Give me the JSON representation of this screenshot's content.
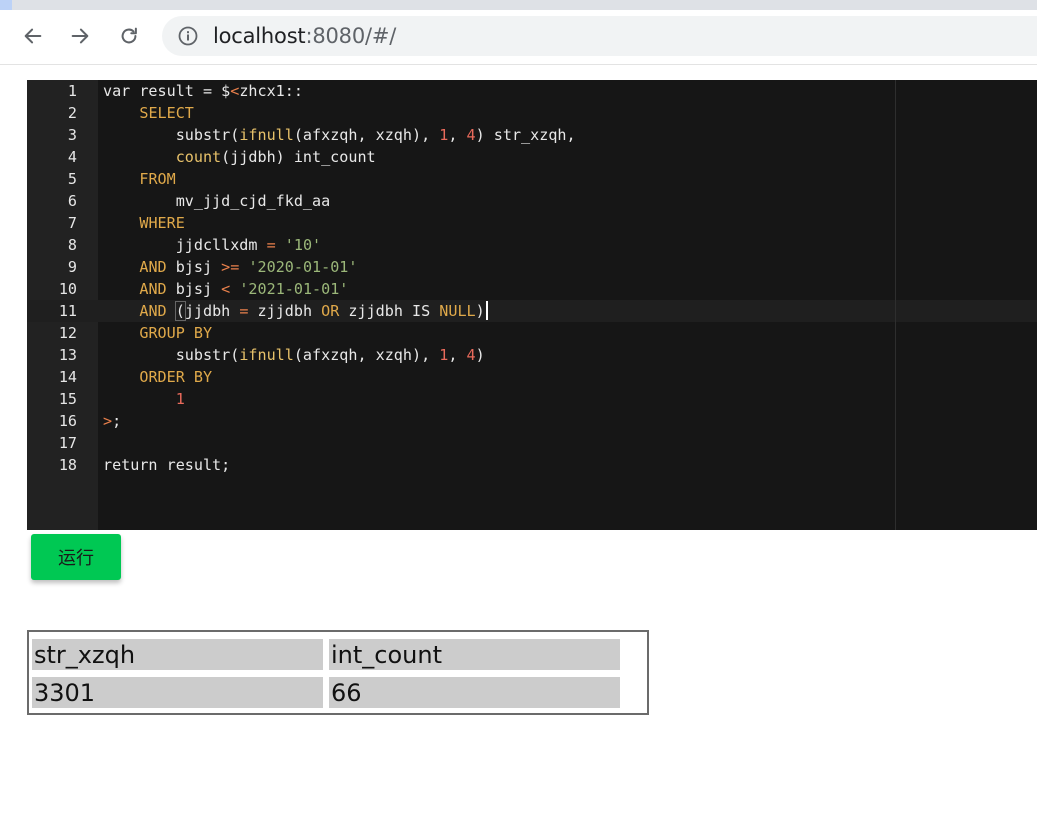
{
  "browser": {
    "url_host": "localhost",
    "url_rest": ":8080/#/"
  },
  "editor": {
    "active_line": 11,
    "lines": [
      {
        "n": "1",
        "tokens": [
          [
            "",
            "var result = $"
          ],
          [
            "op",
            "<"
          ],
          [
            "",
            "zhcx1::"
          ]
        ]
      },
      {
        "n": "2",
        "tokens": [
          [
            "",
            "    "
          ],
          [
            "kw",
            "SELECT"
          ]
        ]
      },
      {
        "n": "3",
        "tokens": [
          [
            "",
            "        substr("
          ],
          [
            "fn",
            "ifnull"
          ],
          [
            "",
            "(afxzqh, xzqh), "
          ],
          [
            "num",
            "1"
          ],
          [
            "",
            ", "
          ],
          [
            "num",
            "4"
          ],
          [
            "",
            ") str_xzqh,"
          ]
        ]
      },
      {
        "n": "4",
        "tokens": [
          [
            "",
            "        "
          ],
          [
            "fn",
            "count"
          ],
          [
            "",
            "(jjdbh) int_count"
          ]
        ]
      },
      {
        "n": "5",
        "tokens": [
          [
            "",
            "    "
          ],
          [
            "kw",
            "FROM"
          ]
        ]
      },
      {
        "n": "6",
        "tokens": [
          [
            "",
            "        mv_jjd_cjd_fkd_aa"
          ]
        ]
      },
      {
        "n": "7",
        "tokens": [
          [
            "",
            "    "
          ],
          [
            "kw",
            "WHERE"
          ]
        ]
      },
      {
        "n": "8",
        "tokens": [
          [
            "",
            "        jjdcllxdm "
          ],
          [
            "op",
            "="
          ],
          [
            "",
            " "
          ],
          [
            "str",
            "'10'"
          ]
        ]
      },
      {
        "n": "9",
        "tokens": [
          [
            "",
            "    "
          ],
          [
            "kw",
            "AND"
          ],
          [
            "",
            " bjsj "
          ],
          [
            "op",
            ">="
          ],
          [
            "",
            " "
          ],
          [
            "str",
            "'2020-01-01'"
          ]
        ]
      },
      {
        "n": "10",
        "tokens": [
          [
            "",
            "    "
          ],
          [
            "kw",
            "AND"
          ],
          [
            "",
            " bjsj "
          ],
          [
            "op",
            "<"
          ],
          [
            "",
            " "
          ],
          [
            "str",
            "'2021-01-01'"
          ]
        ]
      },
      {
        "n": "11",
        "tokens": [
          [
            "",
            "    "
          ],
          [
            "kw",
            "AND"
          ],
          [
            "",
            " "
          ],
          [
            "bracket",
            "("
          ],
          [
            "",
            "jjdbh "
          ],
          [
            "op",
            "="
          ],
          [
            "",
            " zjjdbh "
          ],
          [
            "kw",
            "OR"
          ],
          [
            "",
            " zjjdbh IS "
          ],
          [
            "kw",
            "NULL"
          ],
          [
            "",
            ")"
          ],
          [
            "cursor",
            ""
          ]
        ]
      },
      {
        "n": "12",
        "tokens": [
          [
            "",
            "    "
          ],
          [
            "kw",
            "GROUP BY"
          ]
        ]
      },
      {
        "n": "13",
        "tokens": [
          [
            "",
            "        substr("
          ],
          [
            "fn",
            "ifnull"
          ],
          [
            "",
            "(afxzqh, xzqh), "
          ],
          [
            "num",
            "1"
          ],
          [
            "",
            ", "
          ],
          [
            "num",
            "4"
          ],
          [
            "",
            ")"
          ]
        ]
      },
      {
        "n": "14",
        "tokens": [
          [
            "",
            "    "
          ],
          [
            "kw",
            "ORDER BY"
          ]
        ]
      },
      {
        "n": "15",
        "tokens": [
          [
            "",
            "        "
          ],
          [
            "num",
            "1"
          ]
        ]
      },
      {
        "n": "16",
        "tokens": [
          [
            "op",
            ">"
          ],
          [
            "",
            ";"
          ]
        ]
      },
      {
        "n": "17",
        "tokens": [
          [
            "",
            ""
          ]
        ]
      },
      {
        "n": "18",
        "tokens": [
          [
            "",
            "return result;"
          ]
        ]
      }
    ]
  },
  "run_button": {
    "label": "运行"
  },
  "result_table": {
    "headers": [
      "str_xzqh",
      "int_count"
    ],
    "rows": [
      [
        "3301",
        "66"
      ]
    ]
  },
  "colors": {
    "editor_bg": "#161616",
    "gutter_bg": "#222222",
    "keyword": "#e0a94a",
    "number": "#e96a5b",
    "string": "#9bb779",
    "run_button": "#00c853"
  }
}
